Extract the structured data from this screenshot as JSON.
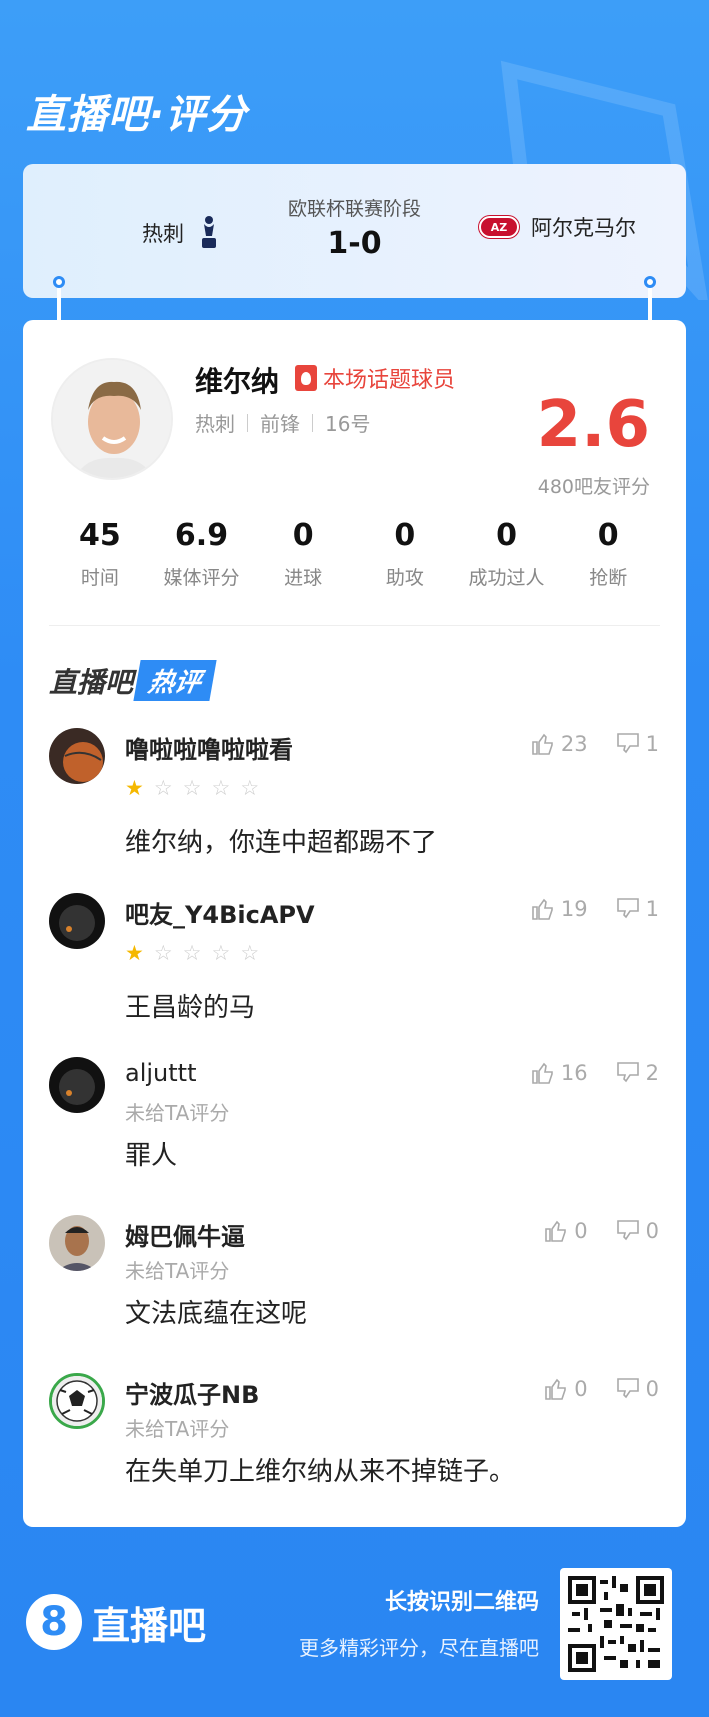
{
  "header": {
    "title": "直播吧·评分"
  },
  "match": {
    "home_team": "热刺",
    "away_team": "阿尔克马尔",
    "away_logo_text": "AZ",
    "stage": "欧联杯联赛阶段",
    "score": "1-0"
  },
  "player": {
    "name": "维尔纳",
    "hot_tag": "本场话题球员",
    "team": "热刺",
    "position": "前锋",
    "number": "16号",
    "rating": "2.6",
    "rating_sub": "480吧友评分"
  },
  "stats": [
    {
      "value": "45",
      "label": "时间"
    },
    {
      "value": "6.9",
      "label": "媒体评分"
    },
    {
      "value": "0",
      "label": "进球"
    },
    {
      "value": "0",
      "label": "助攻"
    },
    {
      "value": "0",
      "label": "成功过人"
    },
    {
      "value": "0",
      "label": "抢断"
    }
  ],
  "section": {
    "title_part1": "直播吧",
    "title_part2": "热评"
  },
  "comments": [
    {
      "user": "噜啦啦噜啦啦看",
      "stars": 1,
      "likes": "23",
      "dislikes": "1",
      "text": "维尔纳，你连中超都踢不了"
    },
    {
      "user": "吧友_Y4BicAPV",
      "stars": 1,
      "likes": "19",
      "dislikes": "1",
      "text": "王昌龄的马"
    },
    {
      "user": "aljuttt",
      "unrated": "未给TA评分",
      "likes": "16",
      "dislikes": "2",
      "text": "罪人"
    },
    {
      "user": "姆巴佩牛逼",
      "unrated": "未给TA评分",
      "likes": "0",
      "dislikes": "0",
      "text": "文法底蕴在这呢"
    },
    {
      "user": "宁波瓜子NB",
      "unrated": "未给TA评分",
      "likes": "0",
      "dislikes": "0",
      "text": "在失单刀上维尔纳从来不掉链子。"
    }
  ],
  "footer": {
    "logo_glyph": "8",
    "logo_text": "直播吧",
    "line1": "长按识别二维码",
    "line2": "更多精彩评分，尽在直播吧"
  },
  "colors": {
    "accent": "#2e8cf5",
    "rating": "#e8453c",
    "star": "#f5b800"
  }
}
